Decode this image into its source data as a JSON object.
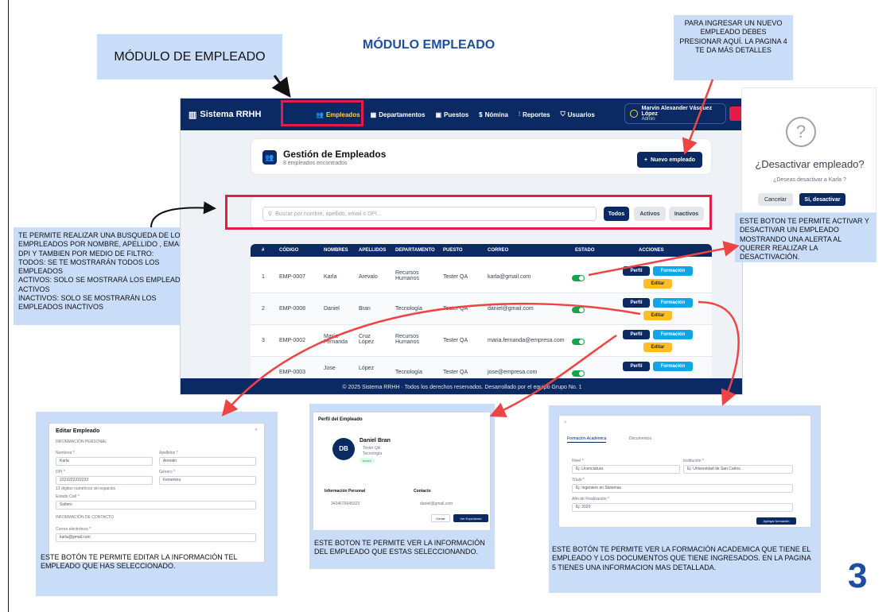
{
  "page_title": "MÓDULO EMPLEADO",
  "page_number": "3",
  "callouts": {
    "modulo": "MÓDULO DE EMPLEADO",
    "nuevo": "PARA INGRESAR UN NUEVO EMPLEADO DEBES PRESIONAR AQUÍ. LA PAGINA 4 TE DA MÁS DETALLES",
    "busqueda": "TE PERMITE REALIZAR UNA BUSQUEDA DE LOS EMPRLEADOS POR NOMBRE, APELLIDO , EMAIL O DPI Y TAMBIEN POR MEDIO DE FILTRO:\nTODOS: SE TE MOSTRARÁN  TODOS LOS EMPLEADOS\nACTIVOS: SOLO SE MOSTRARÁ LOS EMPLEADOS ACTIVOS\nINACTIVOS: SOLO SE MOSTRARÁN LOS EMPLEADOS INACTIVOS",
    "activar": "ESTE BOTON TE PERMITE ACTIVAR Y DESACTIVAR UN EMPLEADO MOSTRANDO UNA ALERTA AL QUERER REALIZAR LA DESACTIVACIÓN.",
    "editar": "ESTE BOTÓN TE PERMITE EDITAR LA INFORMACIÓN TEL EMPLEADO QUE HAS SELECCIONADO.",
    "perfil": "ESTE BOTON TE PERMITE VER LA INFORMACIÓN DEL EMPLEADO QUE ESTAS SELECCIONANDO.",
    "formacion": "ESTE BOTÓN TE PERMITE VER LA FORMACIÓN ACADEMICA QUE TIENE EL EMPLEADO Y LOS DOCUMENTOS QUE TIENE INGRESADOS. EN LA PAGINA 5 TIENES UNA INFORMACION MAS DETALLADA."
  },
  "app": {
    "brand": "Sistema RRHH",
    "nav": [
      "Empleados",
      "Departamentos",
      "Puestos",
      "Nómina",
      "Reportes",
      "Usuarios"
    ],
    "user_name": "Marvin Alexander Vásquez López",
    "user_role": "Admin",
    "header_title": "Gestión de Empleados",
    "header_sub": "8 empleados encontrados",
    "new_button": "Nuevo empleado",
    "search_placeholder": "Buscar por nombre, apellido, email o DPI...",
    "filters": [
      "Todos",
      "Activos",
      "Inactivos"
    ],
    "columns": [
      "#",
      "CÓDIGO",
      "NOMBRES",
      "APELLIDOS",
      "DEPARTAMENTO",
      "PUESTO",
      "CORREO",
      "ESTADO",
      "ACCIONES"
    ],
    "rows": [
      {
        "n": "1",
        "codigo": "EMP-0007",
        "nombres": "Karla",
        "apellidos": "Arevalo",
        "depto": "Recursos Humanos",
        "puesto": "Tester QA",
        "correo": "karla@gmail.com"
      },
      {
        "n": "2",
        "codigo": "EMP-0008",
        "nombres": "Daniel",
        "apellidos": "Bran",
        "depto": "Tecnología",
        "puesto": "Tester QA",
        "correo": "daniel@gmail.com"
      },
      {
        "n": "3",
        "codigo": "EMP-0002",
        "nombres": "María Fernanda",
        "apellidos": "Cruz López",
        "depto": "Recursos Humanos",
        "puesto": "Tester QA",
        "correo": "maria.fernanda@empresa.com"
      },
      {
        "n": "",
        "codigo": "EMP-0003",
        "nombres": "Jose",
        "apellidos": "López",
        "depto": "Tecnología",
        "puesto": "Tester QA",
        "correo": "jose@empresa.com"
      }
    ],
    "btn_perfil": "Perfil",
    "btn_formacion": "Formación",
    "btn_editar": "Editar",
    "footer": "© 2025 Sistema RRHH · Todos los derechos reservados. Desarrollado por el equipo Grupo No. 1"
  },
  "modal": {
    "icon": "?",
    "title": "¿Desactivar empleado?",
    "message": "¿Deseas desactivar a Karla ?",
    "cancel": "Cancelar",
    "confirm": "Sí, desactivar"
  },
  "edit_form": {
    "title": "Editar Empleado",
    "section1": "INFORMACIÓN PERSONAL",
    "nombres_label": "Nombres *",
    "nombres_value": "Karla",
    "apellidos_label": "Apellidos *",
    "apellidos_value": "Arevalo",
    "dpi_label": "DPI *",
    "dpi_value": "2222222222222",
    "dpi_hint": "13 dígitos numéricos sin espacios",
    "genero_label": "Género *",
    "genero_value": "Femenino",
    "civil_label": "Estado Civil *",
    "civil_value": "Soltero",
    "section2": "INFORMACIÓN DE CONTACTO",
    "email_label": "Correo electrónico *",
    "email_value": "karla@gmail.com"
  },
  "profile": {
    "title": "Perfil del Empleado",
    "initials": "DB",
    "name": "Daniel Bran",
    "puesto": "Tester QA",
    "depto": "Tecnología",
    "estado": "Activo",
    "sec1": "Información Personal",
    "sec2": "Contacto",
    "dpi": "3434676645323",
    "email": "daniel@gmail.com",
    "cerrar": "Cerrar",
    "expediente": "Ver Expediente"
  },
  "formacion": {
    "tab1": "Formación Académica",
    "tab2": "Documentos",
    "nivel_label": "Nivel *",
    "nivel_value": "Ej: Licenciatura",
    "institucion_label": "Institución *",
    "institucion_value": "Ej: Universidad de San Carlos",
    "titulo_label": "Título *",
    "titulo_value": "Ej: Ingeniero en Sistemas",
    "anio_label": "Año de Finalización *",
    "anio_value": "Ej: 2020",
    "agregar": "Agregar formación"
  }
}
